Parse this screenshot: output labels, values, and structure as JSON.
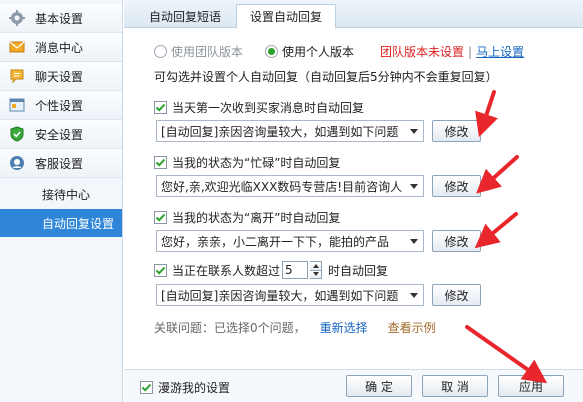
{
  "sidebar": {
    "items": [
      {
        "label": "基本设置",
        "icon": "gear-icon"
      },
      {
        "label": "消息中心",
        "icon": "mail-icon"
      },
      {
        "label": "聊天设置",
        "icon": "chat-icon"
      },
      {
        "label": "个性设置",
        "icon": "window-icon"
      },
      {
        "label": "安全设置",
        "icon": "shield-icon"
      },
      {
        "label": "客服设置",
        "icon": "service-icon"
      }
    ],
    "subitems": [
      {
        "label": "接待中心"
      },
      {
        "label": "自动回复设置"
      }
    ]
  },
  "tabs": [
    {
      "label": "自动回复短语"
    },
    {
      "label": "设置自动回复"
    }
  ],
  "mode": {
    "team_label": "使用团队版本",
    "personal_label": "使用个人版本",
    "team_warning": "团队版本未设置",
    "separator": "|",
    "setup_link": "马上设置"
  },
  "hint": "可勾选并设置个人自动回复（自动回复后5分钟内不会重复回复）",
  "rules": [
    {
      "label": "当天第一次收到买家消息时自动回复",
      "value": "[自动回复]亲因咨询量较大，如遇到如下问题",
      "button": "修改"
    },
    {
      "label": "当我的状态为“忙碌”时自动回复",
      "value": "您好,亲,欢迎光临XXX数码专营店!目前咨询人",
      "button": "修改"
    },
    {
      "label": "当我的状态为“离开”时自动回复",
      "value": "您好，亲亲，小二离开一下下，能拍的产品",
      "button": "修改"
    },
    {
      "label_before": "当正在联系人数超过",
      "count": "5",
      "label_after": "时自动回复",
      "value": "[自动回复]亲因咨询量较大，如遇到如下问题",
      "button": "修改"
    }
  ],
  "related": {
    "text": "关联问题：已选择0个问题，",
    "reselect": "重新选择",
    "example": "查看示例"
  },
  "footer": {
    "roam_label": "漫游我的设置",
    "ok": "确 定",
    "cancel": "取 消",
    "apply": "应用"
  },
  "colors": {
    "accent": "#2f86d8",
    "warning": "#e02222",
    "annotation_arrow": "#e8262b",
    "checked": "#2aa12a"
  }
}
